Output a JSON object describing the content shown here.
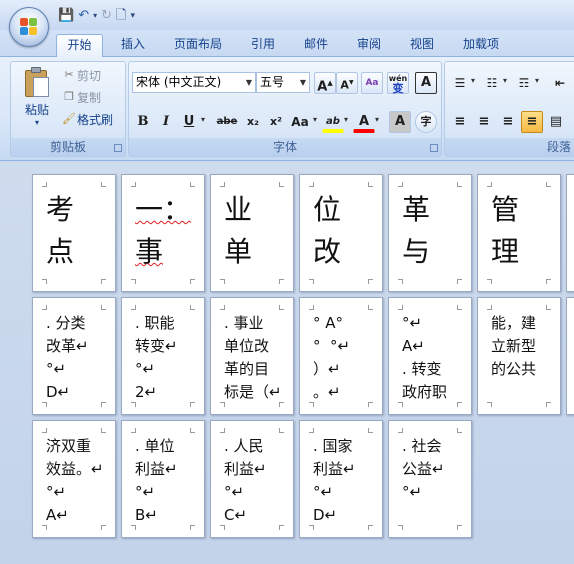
{
  "qat": {
    "save_icon": "save-icon",
    "undo_icon": "undo-icon",
    "redo_icon": "redo-icon",
    "new_icon": "new-document-icon",
    "customize_icon": "customize-qat-icon"
  },
  "tabs": [
    {
      "label": "开始",
      "active": true
    },
    {
      "label": "插入"
    },
    {
      "label": "页面布局"
    },
    {
      "label": "引用"
    },
    {
      "label": "邮件"
    },
    {
      "label": "审阅"
    },
    {
      "label": "视图"
    },
    {
      "label": "加载项"
    }
  ],
  "clipboard": {
    "group_label": "剪贴板",
    "paste_label": "粘贴",
    "cut_label": "剪切",
    "copy_label": "复制",
    "format_painter_label": "格式刷"
  },
  "font": {
    "group_label": "字体",
    "font_name": "宋体 (中文正文)",
    "font_size": "五号",
    "grow_label": "A",
    "shrink_label": "A",
    "clear_label": "Aa",
    "phonetic_label": "wén",
    "phonetic_char": "变",
    "border_label": "A",
    "bold_label": "B",
    "italic_label": "I",
    "underline_label": "U",
    "strike_label": "abe",
    "subscript_label": "x₂",
    "superscript_label": "x²",
    "case_label": "Aa",
    "highlight_label": "ab",
    "font_color_label": "A",
    "shading_label": "A",
    "enclose_label": "字"
  },
  "paragraph": {
    "group_label": "段落"
  },
  "pages": {
    "p1": "考\n点",
    "p2": "一：\n事",
    "p3": "业\n单",
    "p4": "位\n改",
    "p5": "革\n与",
    "p6": "管\n理",
    "p7": ". 分类\n改革↵\n°↵\nD↵",
    "p8": ". 职能\n转变↵\n°↵\n2↵",
    "p9": ". 事业\n单位改\n革的目\n标是（↵",
    "p10": "° A°\n°  °↵\n）↵\n。↵",
    "p11": "°↵\nA↵\n. 转变\n政府职",
    "p12": "能，建\n立新型\n的公共",
    "p13": "济双重\n效益。↵\n°↵\nA↵",
    "p14": ". 单位\n利益↵\n°↵\nB↵",
    "p15": ". 人民\n利益↵\n°↵\nC↵",
    "p16": ". 国家\n利益↵\n°↵\nD↵",
    "p17": ". 社会\n公益↵\n°↵"
  },
  "colors": {
    "ribbon_text": "#15428b",
    "highlight": "#ffff00",
    "font_color": "#ff0000",
    "spelling_mark": "#e02020"
  }
}
